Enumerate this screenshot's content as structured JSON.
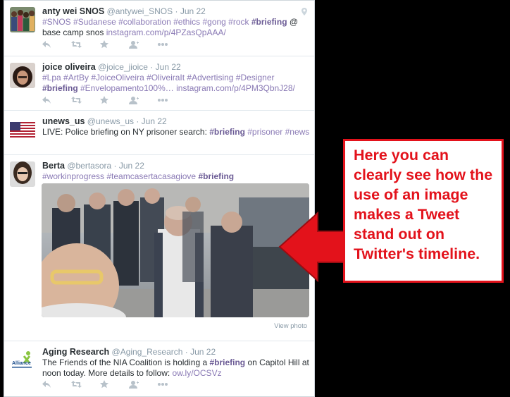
{
  "tweets": [
    {
      "name": "anty wei SNOS",
      "handle": "@antywei_SNOS",
      "date": "Jun 22",
      "text_parts": [
        "#SNOS #Sudanese #collaboration #ethics #gong #rock ",
        "#briefing",
        " @ base camp snos ",
        "instagram.com/p/4PZasQpAAA/"
      ]
    },
    {
      "name": "joice oliveira",
      "handle": "@joice_jioice",
      "date": "Jun 22",
      "text_parts": [
        "#Lpa #ArtBy #JoiceOliveira #OliveiraIt #Advertising #Designer ",
        "#briefing",
        " #Envelopamento100%… ",
        "instagram.com/p/4PM3QbnJ28/"
      ]
    },
    {
      "name": "unews_us",
      "handle": "@unews_us",
      "date": "Jun 22",
      "text_parts": [
        "LIVE: Police briefing on NY prisoner search: ",
        "#briefing",
        " #prisoner ",
        "#news"
      ]
    },
    {
      "name": "Berta",
      "handle": "@bertasora",
      "date": "Jun 22",
      "text_parts": [
        "#workinprogress #teamcasertacasagiove ",
        "#briefing"
      ],
      "view_photo": "View photo"
    },
    {
      "name": "Aging Research",
      "handle": "@Aging_Research",
      "date": "Jun 22",
      "text_parts": [
        "The Friends of the NIA Coalition is holding a ",
        "#briefing",
        " on Capitol Hill at noon today. More details to follow: ",
        "ow.ly/OCSVz"
      ],
      "avatar_label": "Alliance"
    }
  ],
  "callout": {
    "text": "Here you can clearly see how the use of an image makes a Tweet stand out on Twitter's timeline.",
    "color": "#e3121b"
  },
  "icons": [
    "reply-icon",
    "retweet-icon",
    "favorite-icon",
    "follow-icon",
    "more-icon",
    "location-icon"
  ]
}
